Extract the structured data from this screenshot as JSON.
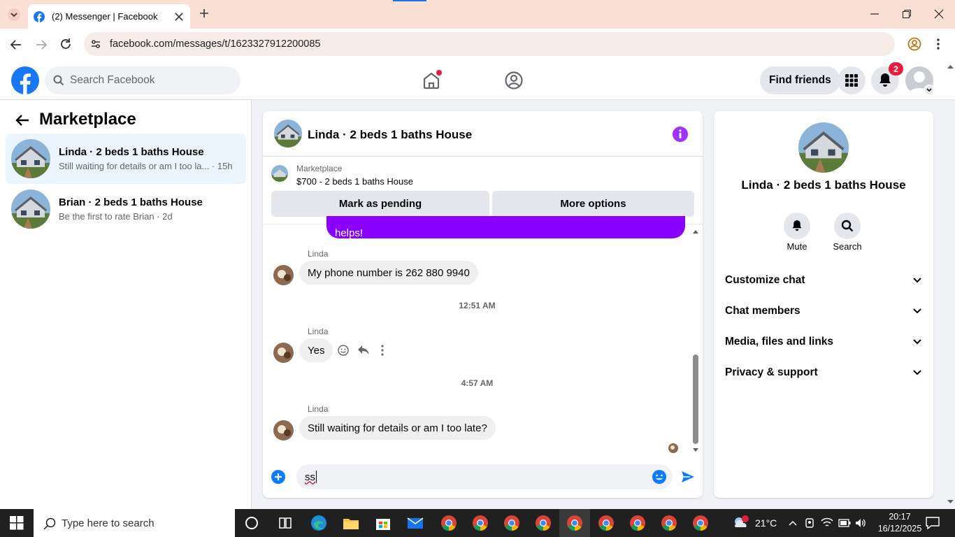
{
  "browser": {
    "tab_title": "(2) Messenger | Facebook",
    "url": "facebook.com/messages/t/1623327912200085"
  },
  "fb_header": {
    "search_placeholder": "Search Facebook",
    "find_friends": "Find friends",
    "notification_count": "2"
  },
  "sidebar": {
    "title": "Marketplace",
    "conversations": [
      {
        "name": "Linda · 2 beds 1 baths House",
        "preview": "Still waiting for details or am I too la... · 15h"
      },
      {
        "name": "Brian · 2 beds 1 baths House",
        "preview": "Be the first to rate Brian · 2d"
      }
    ]
  },
  "chat": {
    "title": "Linda · 2 beds 1 baths House",
    "listing_source": "Marketplace",
    "listing_title": "$700 - 2 beds 1 baths House",
    "mark_pending": "Mark as pending",
    "more_options": "More options",
    "outgoing_partial": "helps!",
    "messages": [
      {
        "sender": "Linda",
        "text": "My phone number is 262 880 9940"
      },
      {
        "time": "12:51 AM"
      },
      {
        "sender": "Linda",
        "text": "Yes"
      },
      {
        "time": "4:57 AM"
      },
      {
        "sender": "Linda",
        "text": "Still waiting for details or am I too late?"
      }
    ],
    "composer_value": "ss"
  },
  "details": {
    "title": "Linda · 2 beds 1 baths House",
    "mute": "Mute",
    "search": "Search",
    "sections": [
      "Customize chat",
      "Chat members",
      "Media, files and links",
      "Privacy & support"
    ]
  },
  "taskbar": {
    "search_placeholder": "Type here to search",
    "weather": "21°C",
    "time": "20:17",
    "date": "16/12/2025"
  },
  "colors": {
    "fb_blue": "#1877f2",
    "messenger_purple": "#a033ff",
    "outgoing_bubble": "#8a00ff"
  }
}
